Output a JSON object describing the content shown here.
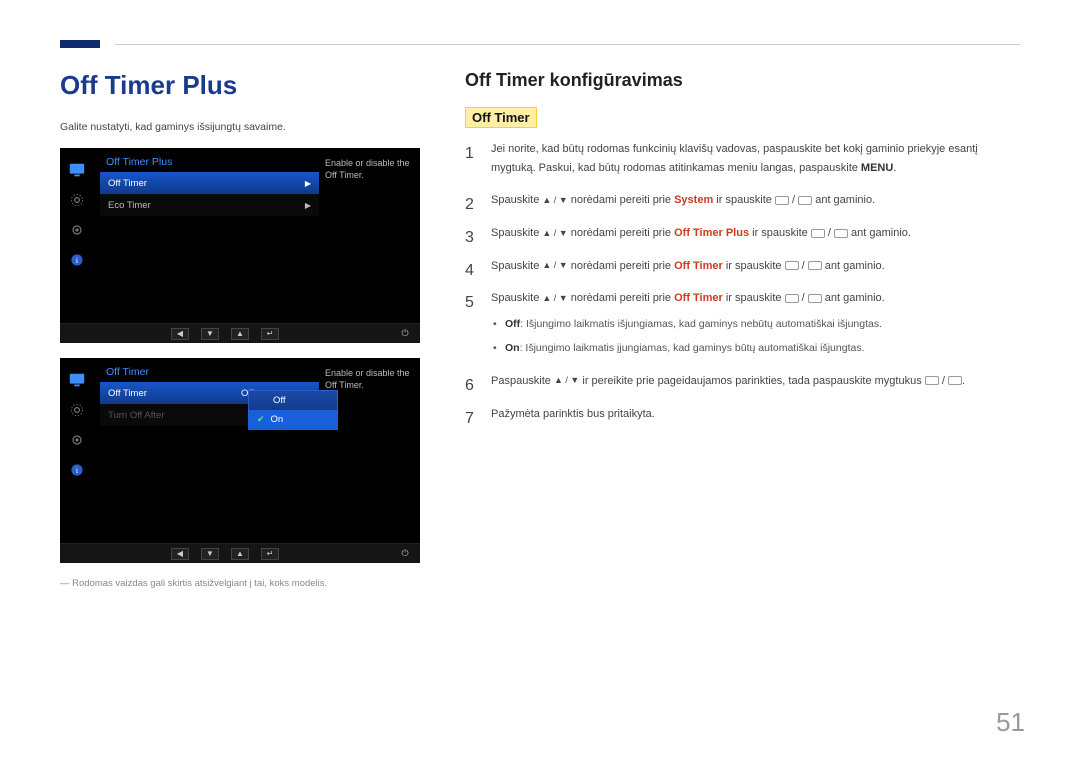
{
  "page": {
    "main_title": "Off Timer Plus",
    "intro": "Galite nustatyti, kad gaminys išsijungtų savaime.",
    "footnote": "― Rodomas vaizdas gali skirtis atsižvelgiant į tai, koks modelis.",
    "page_number": "51"
  },
  "osd1": {
    "title": "Off Timer Plus",
    "row1": "Off Timer",
    "row2": "Eco Timer",
    "desc": "Enable or disable the Off Timer."
  },
  "osd2": {
    "title": "Off Timer",
    "row1_label": "Off Timer",
    "row1_value": "Off",
    "row2_label": "Turn Off After",
    "drop_off": "Off",
    "drop_on": "On",
    "desc": "Enable or disable the Off Timer."
  },
  "right": {
    "section_title": "Off Timer konfigūravimas",
    "sub_label": "Off Timer",
    "steps": {
      "s1a": "Jei norite, kad būtų rodomas funkcinių klavišų vadovas, paspauskite bet kokį gaminio priekyje esantį mygtuką. Paskui, kad būtų rodomas atitinkamas meniu langas, paspauskite ",
      "s1b": "MENU",
      "s1c": ".",
      "s2a": "Spauskite ",
      "s2b": " norėdami pereiti prie ",
      "s2_system": "System",
      "s2c": " ir spauskite ",
      "s2d": " ant gaminio.",
      "s3_target": "Off Timer Plus",
      "s3c": " ir spauskite ",
      "s4_target": "Off Timer",
      "s5_target": "Off Timer",
      "b_off_label": "Off",
      "b_off_text": ": Išjungimo laikmatis išjungiamas, kad gaminys nebūtų automatiškai išjungtas.",
      "b_on_label": "On",
      "b_on_text": ": Išjungimo laikmatis įjungiamas, kad gaminys būtų automatiškai išjungtas.",
      "s6a": "Paspauskite ",
      "s6b": " ir pereikite prie pageidaujamos parinkties, tada paspauskite mygtukus ",
      "s6c": ".",
      "s7": "Pažymėta parinktis bus pritaikyta."
    },
    "arrows": "▲ / ▼"
  }
}
